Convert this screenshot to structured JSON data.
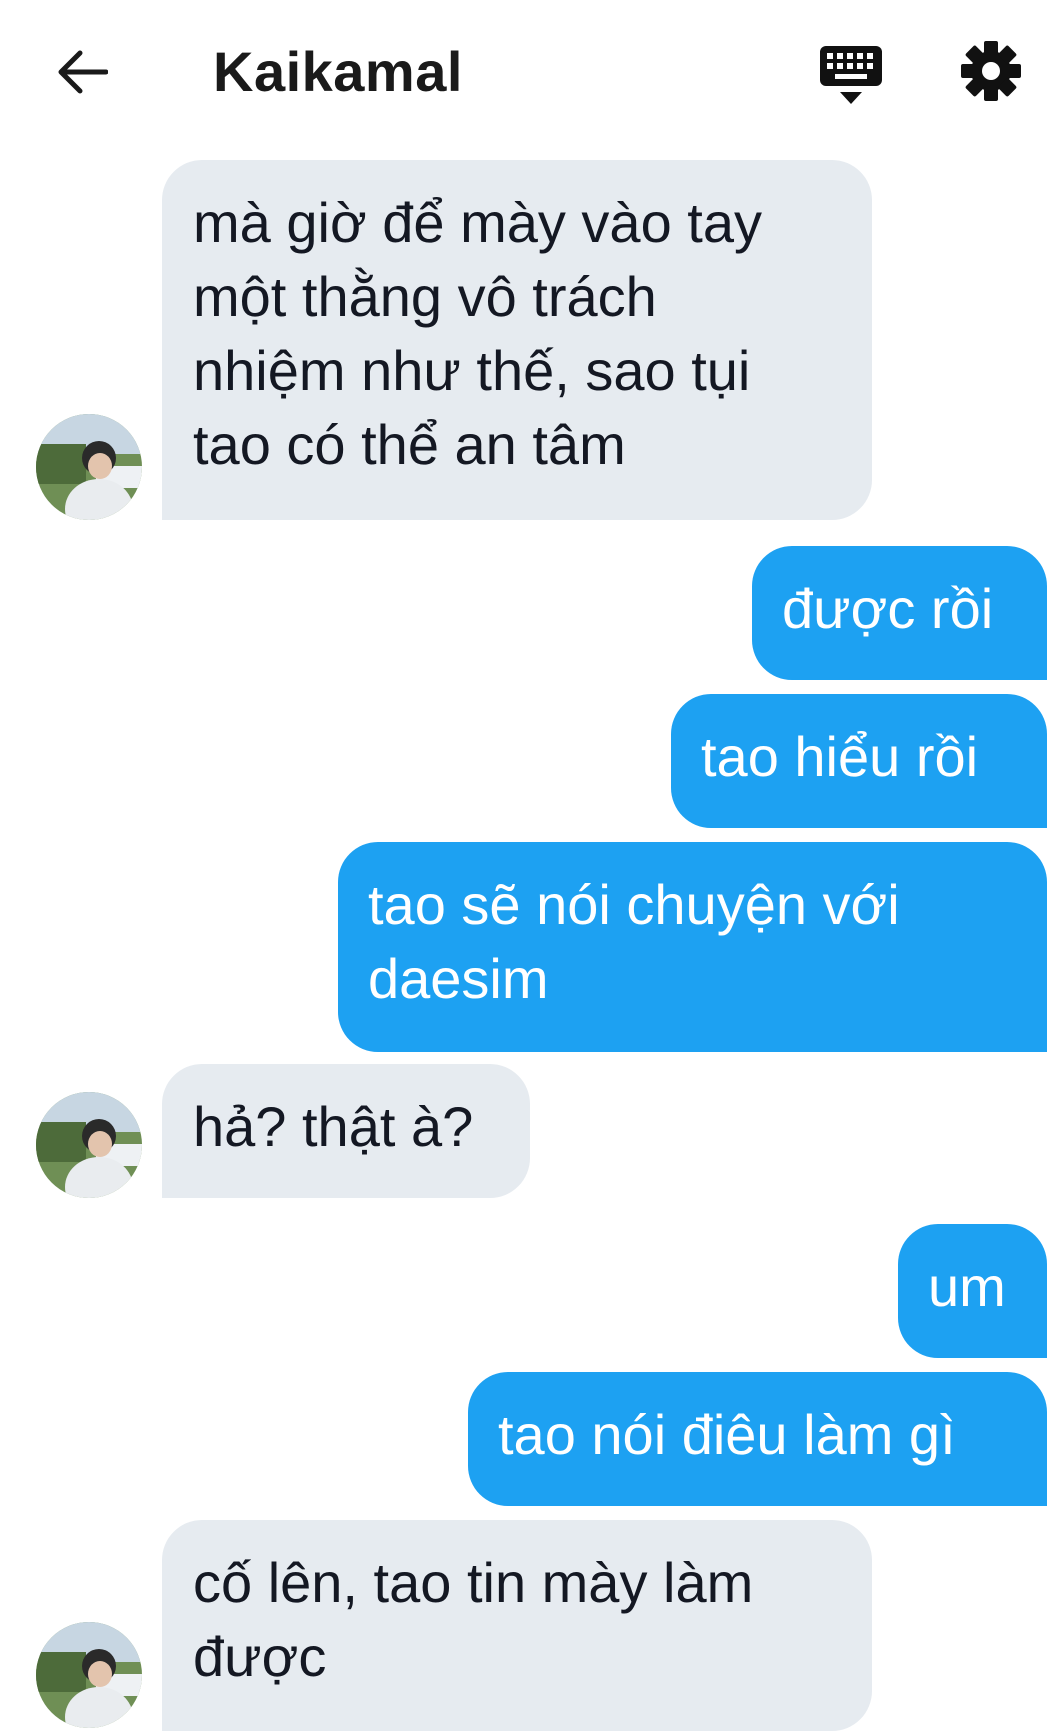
{
  "header": {
    "back_icon": "arrow-left-icon",
    "title": "Kaikamal",
    "keyboard_icon": "keyboard-icon",
    "settings_icon": "gear-icon"
  },
  "colors": {
    "incoming_bubble": "#e6ebf0",
    "outgoing_bubble": "#1da1f2",
    "incoming_text": "#141823",
    "outgoing_text": "#ffffff"
  },
  "messages": [
    {
      "direction": "in",
      "lines": [
        "mà giờ để mày vào tay",
        "một thằng vô trách",
        "nhiệm như thế, sao tụi",
        "tao có thể an tâm"
      ]
    },
    {
      "direction": "out",
      "lines": [
        "được rồi"
      ]
    },
    {
      "direction": "out",
      "lines": [
        "tao hiểu rồi"
      ]
    },
    {
      "direction": "out",
      "lines": [
        "tao sẽ nói chuyện với",
        "daesim"
      ]
    },
    {
      "direction": "in",
      "lines": [
        "hả? thật à?"
      ]
    },
    {
      "direction": "out",
      "lines": [
        "um"
      ]
    },
    {
      "direction": "out",
      "lines": [
        "tao nói điêu làm gì"
      ]
    },
    {
      "direction": "in",
      "lines": [
        "cố lên, tao tin mày làm",
        "được"
      ]
    }
  ]
}
